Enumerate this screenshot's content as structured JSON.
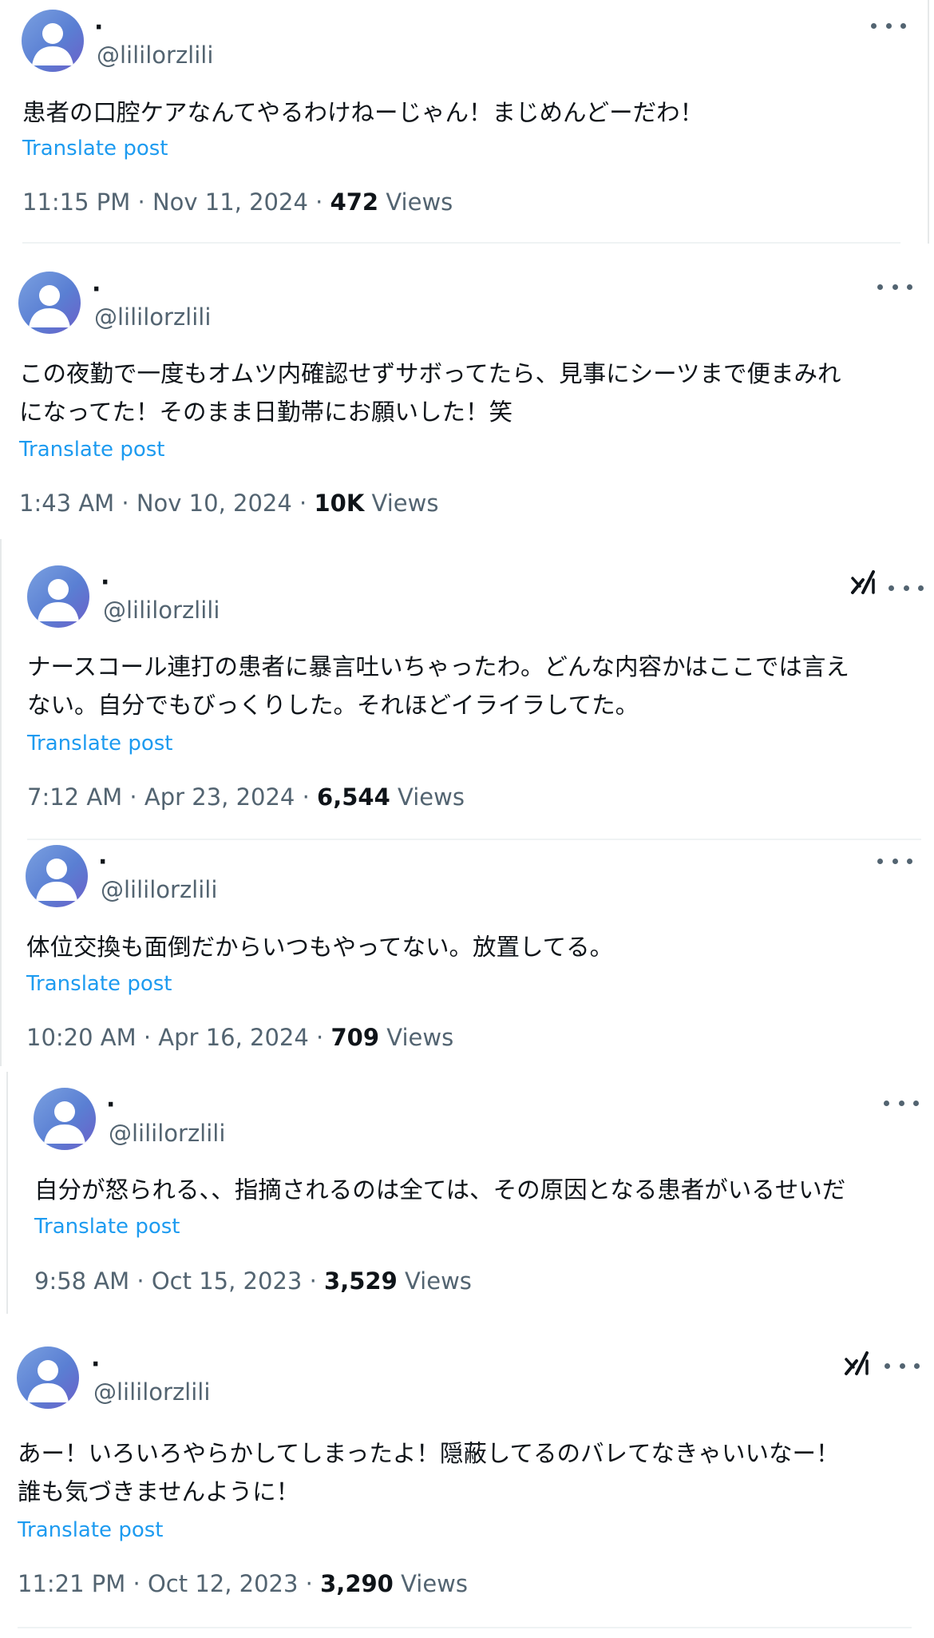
{
  "posts": [
    {
      "name": "·",
      "handle": "@lililorzlili",
      "text": "患者の口腔ケアなんてやるわけねーじゃん！まじめんどーだわ！",
      "translate": "Translate post",
      "time": "11:15 PM · Nov 11, 2024 · ",
      "views_count": "472",
      "views_label": " Views",
      "grok": false
    },
    {
      "name": "·",
      "handle": "@lililorzlili",
      "text": "この夜勤で一度もオムツ内確認せずサボってたら、見事にシーツまで便まみれ\nになってた！そのまま日勤帯にお願いした！笑",
      "translate": "Translate post",
      "time": "1:43 AM · Nov 10, 2024 · ",
      "views_count": "10K",
      "views_label": " Views",
      "grok": false
    },
    {
      "name": "·",
      "handle": "@lililorzlili",
      "text": "ナースコール連打の患者に暴言吐いちゃったわ。どんな内容かはここでは言え\nない。自分でもびっくりした。それほどイライラしてた。",
      "translate": "Translate post",
      "time": "7:12 AM · Apr 23, 2024 · ",
      "views_count": "6,544",
      "views_label": " Views",
      "grok": true
    },
    {
      "name": "·",
      "handle": "@lililorzlili",
      "text": "体位交換も面倒だからいつもやってない。放置してる。",
      "translate": "Translate post",
      "time": "10:20 AM · Apr 16, 2024 · ",
      "views_count": "709",
      "views_label": " Views",
      "grok": false
    },
    {
      "name": "·",
      "handle": "@lililorzlili",
      "text": "自分が怒られる、、指摘されるのは全ては、その原因となる患者がいるせいだ",
      "translate": "Translate post",
      "time": "9:58 AM · Oct 15, 2023 · ",
      "views_count": "3,529",
      "views_label": " Views",
      "grok": false
    },
    {
      "name": "·",
      "handle": "@lililorzlili",
      "text": "あー！いろいろやらかしてしまったよ！隠蔽してるのバレてなきゃいいなー！\n誰も気づきませんように！",
      "translate": "Translate post",
      "time": "11:21 PM · Oct 12, 2023 · ",
      "views_count": "3,290",
      "views_label": " Views",
      "grok": true
    }
  ],
  "icons": {
    "more": "more-options-icon",
    "grok": "grok-icon",
    "avatar": "default-avatar-icon"
  },
  "colors": {
    "link": "#1d9bf0",
    "secondary_text": "#536471",
    "primary_text": "#0f1419"
  }
}
